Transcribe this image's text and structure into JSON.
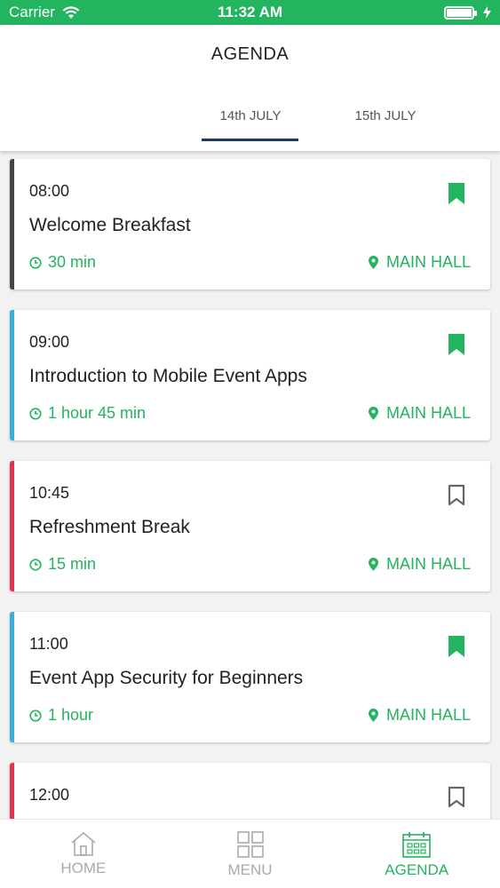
{
  "status_bar": {
    "carrier": "Carrier",
    "time": "11:32 AM"
  },
  "header": {
    "title": "AGENDA",
    "tabs": [
      {
        "label": "14th JULY",
        "active": true
      },
      {
        "label": "15th JULY",
        "active": false
      }
    ]
  },
  "agenda": [
    {
      "time": "08:00",
      "title": "Welcome Breakfast",
      "duration": "30 min",
      "location": "MAIN HALL",
      "accent": "#444444",
      "bookmarked": true
    },
    {
      "time": "09:00",
      "title": "Introduction to Mobile Event Apps",
      "duration": "1 hour 45 min",
      "location": "MAIN HALL",
      "accent": "#3aaed8",
      "bookmarked": true
    },
    {
      "time": "10:45",
      "title": "Refreshment Break",
      "duration": "15 min",
      "location": "MAIN HALL",
      "accent": "#e0344f",
      "bookmarked": false
    },
    {
      "time": "11:00",
      "title": "Event App Security for Beginners",
      "duration": "1 hour",
      "location": "MAIN HALL",
      "accent": "#3aaed8",
      "bookmarked": true
    },
    {
      "time": "12:00",
      "title": "",
      "duration": "",
      "location": "",
      "accent": "#e0344f",
      "bookmarked": false
    }
  ],
  "tab_bar": {
    "items": [
      {
        "label": "HOME",
        "icon": "home-icon",
        "active": false
      },
      {
        "label": "MENU",
        "icon": "grid-icon",
        "active": false
      },
      {
        "label": "AGENDA",
        "icon": "calendar-icon",
        "active": true
      }
    ]
  },
  "colors": {
    "brand_green": "#22b45e",
    "tab_underline": "#1d3a5c",
    "inactive_gray": "#aaaaaa"
  }
}
